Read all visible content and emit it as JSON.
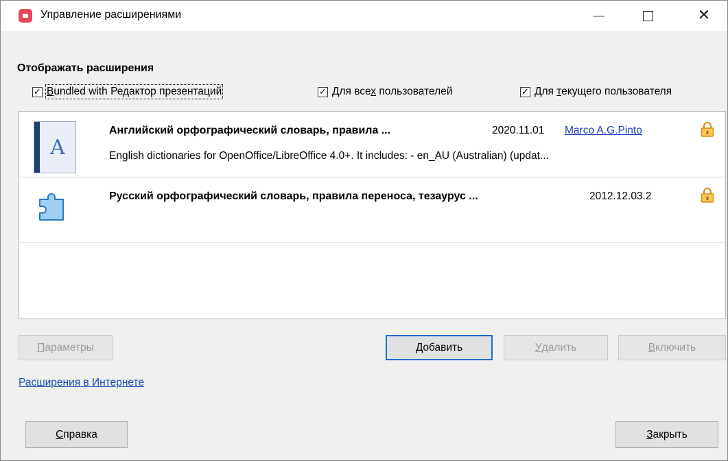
{
  "window": {
    "title": "Управление расширениями",
    "controls": {
      "minimize": "minimize",
      "maximize": "maximize",
      "close": "✕"
    }
  },
  "filter": {
    "section_label": "Отображать расширения",
    "checkboxes": [
      {
        "label_prefix": "",
        "label_underline": "B",
        "label_rest": "undled with Редактор презентаций",
        "checked": true
      },
      {
        "label_prefix": "Для все",
        "label_underline": "х",
        "label_rest": " пользователей",
        "checked": true
      },
      {
        "label_prefix": "Для ",
        "label_underline": "т",
        "label_rest": "екущего пользователя",
        "checked": true
      }
    ]
  },
  "extensions": [
    {
      "icon": "dictionary-icon",
      "icon_letter": "A",
      "title": "Английский орфографический словарь, правила ...",
      "version": "2020.11.01",
      "author": "Marco A.G.Pinto",
      "description": "English dictionaries for OpenOffice/LibreOffice 4.0+.  It includes: - en_AU (Australian) (updat...",
      "locked": true
    },
    {
      "icon": "puzzle-icon",
      "title": "Русский орфографический словарь, правила переноса, тезаурус ...",
      "version": "2012.12.03.2",
      "locked": true
    }
  ],
  "buttons": {
    "params": {
      "u": "П",
      "rest": "араметры"
    },
    "add": {
      "u": "Д",
      "rest": "обавить"
    },
    "remove": {
      "u": "У",
      "rest": "далить"
    },
    "enable": {
      "u": "В",
      "rest": "ключить"
    },
    "help": {
      "u": "С",
      "rest": "правка"
    },
    "close": {
      "u": "З",
      "rest": "акрыть"
    }
  },
  "links": {
    "online": "Расширения в Интернете"
  },
  "colors": {
    "accent": "#1d6fd0",
    "link": "#1a4fb4",
    "app_icon": "#e8495a",
    "lock": "#e8a020"
  }
}
